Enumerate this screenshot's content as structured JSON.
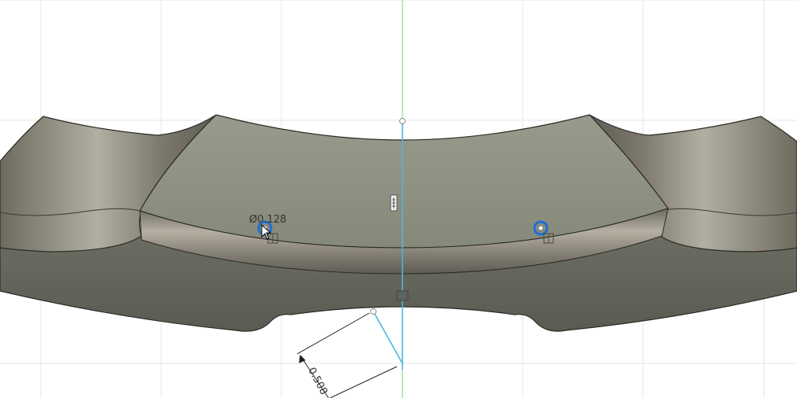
{
  "viewport": {
    "background_color": "#ffffff",
    "grid_color": "#e6e6e6",
    "axis_color": "#7fcc7f",
    "sketch_line_color": "#4ab8dc",
    "selection_color": "#1a6fd8"
  },
  "model": {
    "top_face_color": "#8c8f80",
    "side_face_color": "#65665c",
    "edge_color": "#2a2a26"
  },
  "dimensions": {
    "hole_diameter": "Ø0.128",
    "linear": "0.508"
  },
  "icons": {
    "constraint": "coincident-constraint-icon",
    "cursor": "arrow-cursor-icon"
  }
}
